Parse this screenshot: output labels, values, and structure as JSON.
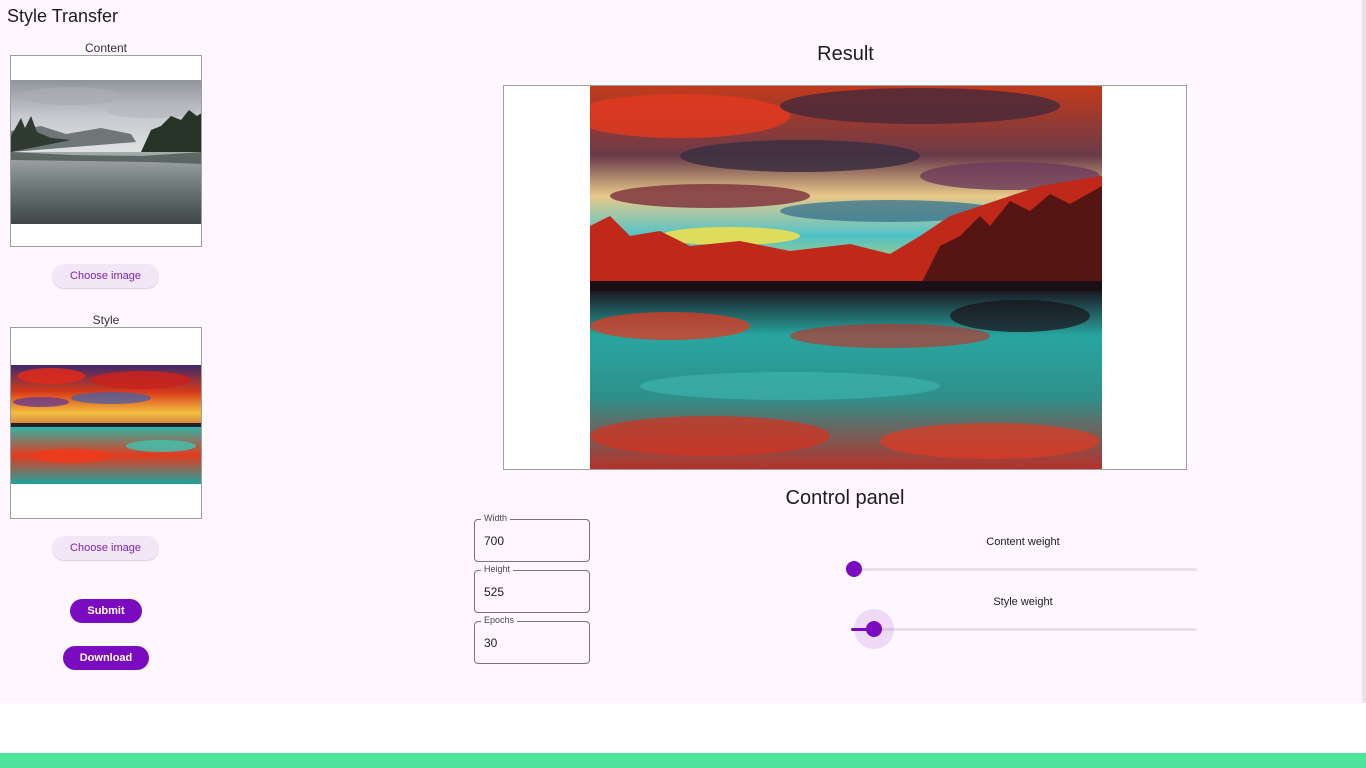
{
  "app": {
    "title": "Style Transfer"
  },
  "content_panel": {
    "label": "Content",
    "choose_button": "Choose image",
    "image": "lake-landscape-photo"
  },
  "style_panel": {
    "label": "Style",
    "choose_button": "Choose image",
    "image": "psychedelic-sunset-lake-painting"
  },
  "actions": {
    "submit": "Submit",
    "download": "Download"
  },
  "result": {
    "title": "Result",
    "image": "stylized-lake-result"
  },
  "control_panel": {
    "title": "Control panel",
    "fields": [
      {
        "label": "Width",
        "value": "700"
      },
      {
        "label": "Height",
        "value": "525"
      },
      {
        "label": "Epochs",
        "value": "30"
      }
    ],
    "sliders": [
      {
        "label": "Content weight",
        "value_fraction": 0.0
      },
      {
        "label": "Style weight",
        "value_fraction": 0.06
      }
    ]
  },
  "colors": {
    "accent": "#7a0bc0",
    "tonal_bg": "#f2e7f6",
    "surface": "#fef7ff",
    "footer": "#4de39b"
  }
}
